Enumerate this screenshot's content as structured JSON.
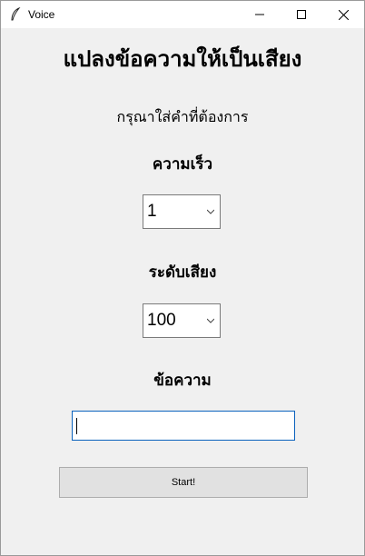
{
  "window": {
    "title": "Voice"
  },
  "heading": "แปลงข้อความให้เป็นเสียง",
  "prompt": "กรุณาใส่คำที่ต้องการ",
  "speed": {
    "label": "ความเร็ว",
    "value": "1"
  },
  "volume": {
    "label": "ระดับเสียง",
    "value": "100"
  },
  "message": {
    "label": "ข้อความ",
    "value": ""
  },
  "start_button": "Start!",
  "icons": [
    "feather-icon",
    "minimize-icon",
    "maximize-icon",
    "close-icon",
    "chevron-down-icon"
  ]
}
